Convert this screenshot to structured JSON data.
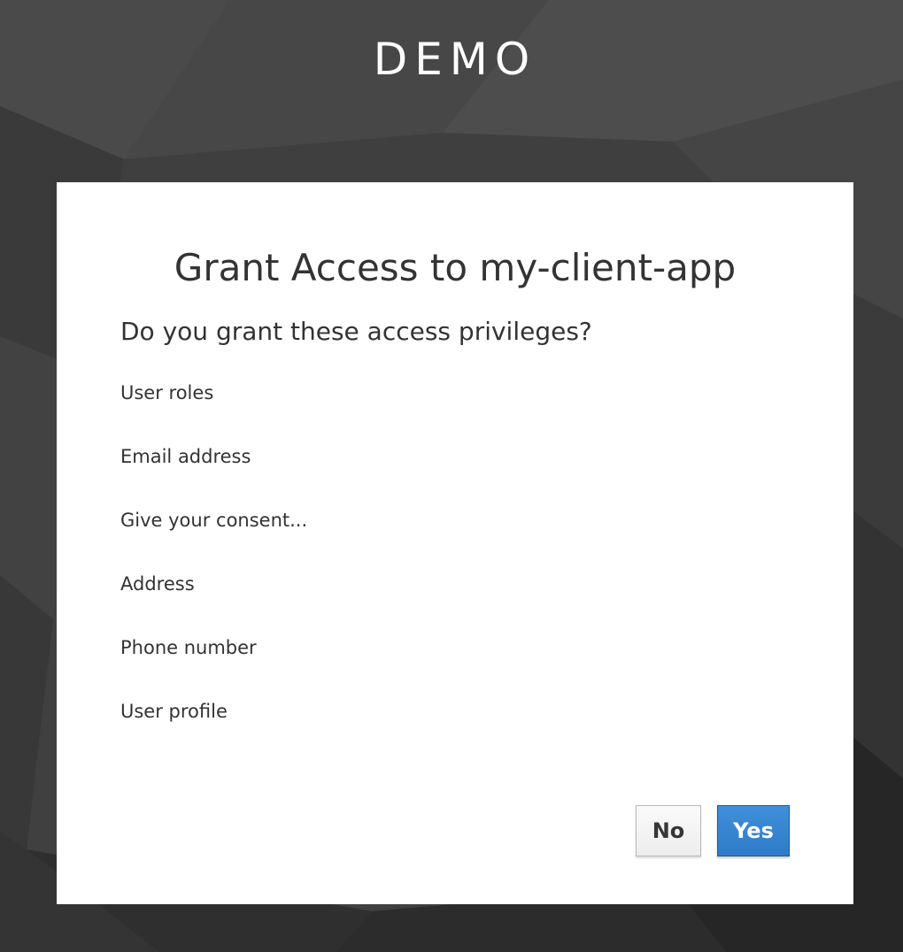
{
  "header": {
    "realm_name": "DEMO"
  },
  "consent": {
    "title": "Grant Access to my-client-app",
    "question": "Do you grant these access privileges?",
    "scopes": [
      "User roles",
      "Email address",
      "Give your consent...",
      "Address",
      "Phone number",
      "User profile"
    ],
    "no_label": "No",
    "yes_label": "Yes"
  },
  "colors": {
    "background": "#3d3d3d",
    "card": "#ffffff",
    "text": "#333333",
    "primary_button": "#3a87d1",
    "secondary_button": "#f2f2f2"
  }
}
